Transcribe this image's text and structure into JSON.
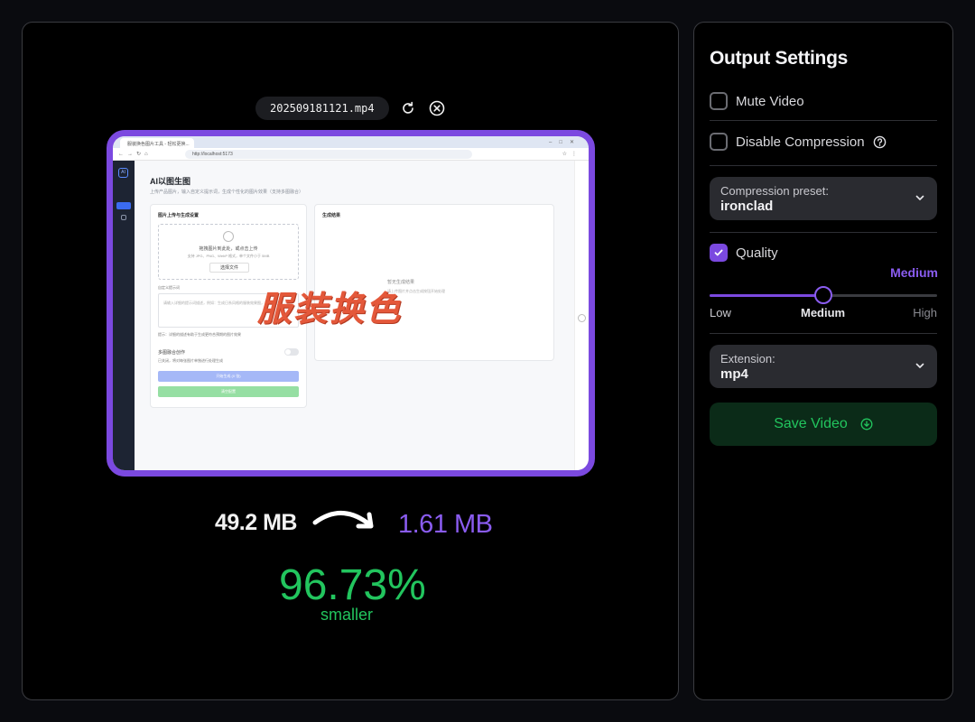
{
  "file": {
    "name": "202509181121.mp4"
  },
  "preview": {
    "browser_tab": "服装换色图片工具 - 轻松更换...",
    "url": "http://localhost:5173",
    "app_title": "AI以图生图",
    "app_subtitle": "上传产品图片，输入自定义提示词，生成个性化的图片效果（支持多图融合）",
    "left_card_title": "图片上传与生成设置",
    "upload_text": "拖拽图片到此处，或点击上传",
    "upload_hint": "支持 JPG、PNG、WebP 格式，单个文件小于 5MB",
    "upload_button": "选择文件",
    "prompt_label": "自定义提示词",
    "prompt_placeholder": "请输入详细的提示词描述，例如：生成日系风格的服装效果图，用户在拍照...",
    "prompt_tip": "提示：详细的描述有助于生成更符合预期的图片效果",
    "fusion_label": "多图融合创作",
    "fusion_tip": "已关闭，将对每张图片单独进行处理生成",
    "generate_button": "开始生成 (0 张)",
    "reset_button": "清空配置",
    "right_card_title": "生成结果",
    "right_empty": "暂无生成结果",
    "right_empty_hint": "请上传图片并点击生成按钮开始处理",
    "watermark": "服装换色"
  },
  "sizes": {
    "original": "49.2 MB",
    "compressed": "1.61 MB"
  },
  "savings": {
    "percent": "96.73%",
    "label": "smaller"
  },
  "settings": {
    "title": "Output Settings",
    "mute_video": {
      "label": "Mute Video",
      "checked": false
    },
    "disable_compression": {
      "label": "Disable Compression",
      "checked": false
    },
    "compression_preset": {
      "label": "Compression preset:",
      "value": "ironclad"
    },
    "quality": {
      "label": "Quality",
      "checked": true,
      "value": "Medium",
      "level_fraction": 0.5,
      "ticks": {
        "low": "Low",
        "medium": "Medium",
        "high": "High"
      }
    },
    "extension": {
      "label": "Extension:",
      "value": "mp4"
    },
    "save_label": "Save Video"
  },
  "colors": {
    "accent": "#7b49e0",
    "success": "#22c55e",
    "panel_border": "#3a3b40",
    "select_bg": "#2a2b30"
  },
  "icons": [
    "refresh-icon",
    "close-circle-icon",
    "arrow-curve-icon",
    "check-icon",
    "help-circle-icon",
    "chevron-down-icon",
    "download-icon"
  ]
}
